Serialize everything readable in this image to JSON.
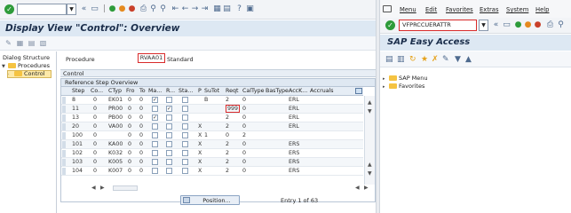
{
  "left_window": {
    "title": "Display View \"Control\": Overview",
    "dialog_structure": {
      "title": "Dialog Structure",
      "items": [
        "Procedures",
        "Control"
      ]
    },
    "procedure": {
      "label": "Procedure",
      "value": "RVAA01",
      "description": "Standard"
    },
    "control_label": "Control",
    "table": {
      "caption": "Reference Step Overview",
      "columns": [
        "Step",
        "Co...",
        "CTyp",
        "Fro",
        "To",
        "Ma...",
        "R...",
        "Sta...",
        "P",
        "SuTot",
        "Reqt",
        "CalType",
        "BasType",
        "AccK...",
        "Accruals"
      ],
      "rows": [
        {
          "step": "8",
          "co": "0",
          "ctyp": "EK01",
          "fro": "0",
          "to": "0",
          "ma": true,
          "r": false,
          "sta": false,
          "p": "",
          "sutot": "B",
          "reqt": "2",
          "caltype": "0",
          "bastype": "",
          "acck": "ERL",
          "accruals": ""
        },
        {
          "step": "11",
          "co": "0",
          "ctyp": "PR00",
          "fro": "0",
          "to": "0",
          "ma": false,
          "r": true,
          "sta": false,
          "p": "",
          "sutot": "",
          "reqt": "999",
          "caltype": "0",
          "bastype": "",
          "acck": "ERL",
          "accruals": ""
        },
        {
          "step": "13",
          "co": "0",
          "ctyp": "PB00",
          "fro": "0",
          "to": "0",
          "ma": true,
          "r": false,
          "sta": false,
          "p": "",
          "sutot": "",
          "reqt": "2",
          "caltype": "0",
          "bastype": "",
          "acck": "ERL",
          "accruals": ""
        },
        {
          "step": "20",
          "co": "0",
          "ctyp": "VA00",
          "fro": "0",
          "to": "0",
          "ma": false,
          "r": false,
          "sta": false,
          "p": "X",
          "sutot": "",
          "reqt": "2",
          "caltype": "0",
          "bastype": "",
          "acck": "ERL",
          "accruals": ""
        },
        {
          "step": "100",
          "co": "0",
          "ctyp": "",
          "fro": "0",
          "to": "0",
          "ma": false,
          "r": false,
          "sta": false,
          "p": "X",
          "sutot": "1",
          "reqt": "0",
          "caltype": "2",
          "bastype": "",
          "acck": "",
          "accruals": ""
        },
        {
          "step": "101",
          "co": "0",
          "ctyp": "KA00",
          "fro": "0",
          "to": "0",
          "ma": false,
          "r": false,
          "sta": false,
          "p": "X",
          "sutot": "",
          "reqt": "2",
          "caltype": "0",
          "bastype": "",
          "acck": "ERS",
          "accruals": ""
        },
        {
          "step": "102",
          "co": "0",
          "ctyp": "K032",
          "fro": "0",
          "to": "0",
          "ma": false,
          "r": false,
          "sta": false,
          "p": "X",
          "sutot": "",
          "reqt": "2",
          "caltype": "0",
          "bastype": "",
          "acck": "ERS",
          "accruals": ""
        },
        {
          "step": "103",
          "co": "0",
          "ctyp": "K005",
          "fro": "0",
          "to": "0",
          "ma": false,
          "r": false,
          "sta": false,
          "p": "X",
          "sutot": "",
          "reqt": "2",
          "caltype": "0",
          "bastype": "",
          "acck": "ERS",
          "accruals": ""
        },
        {
          "step": "104",
          "co": "0",
          "ctyp": "K007",
          "fro": "0",
          "to": "0",
          "ma": false,
          "r": false,
          "sta": false,
          "p": "X",
          "sutot": "",
          "reqt": "2",
          "caltype": "0",
          "bastype": "",
          "acck": "ERS",
          "accruals": ""
        }
      ]
    },
    "position_button": "Position...",
    "entry_text": "Entry 1 of 63"
  },
  "right_window": {
    "menu": [
      "Menu",
      "Edit",
      "Favorites",
      "Extras",
      "System",
      "Help"
    ],
    "command_field": "VFPRCCUERATTR",
    "title": "SAP Easy Access",
    "tree": [
      "SAP Menu",
      "Favorites"
    ]
  },
  "colors": {
    "highlight_red": "#d92b2b",
    "title_bar": "#dde8f3",
    "selected_node": "#fde9a8",
    "ok_green": "#2e9b3a"
  },
  "icons": [
    "ok-icon",
    "save-icon",
    "back-icon",
    "exit-icon",
    "cancel-icon",
    "print-icon",
    "find-icon",
    "page-icons",
    "layout-icon",
    "help-icon",
    "settings-icon",
    "folder-icon"
  ]
}
